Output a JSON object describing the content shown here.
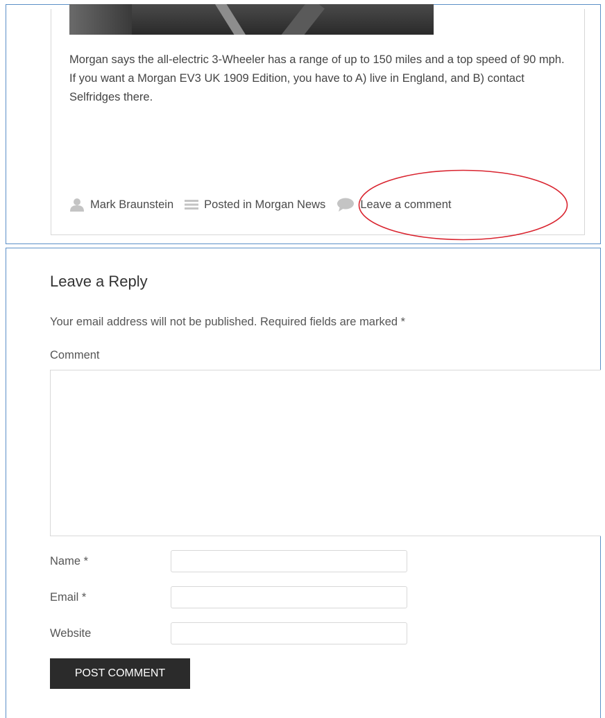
{
  "article": {
    "body_text": "Morgan says the all-electric 3-Wheeler has a range of up to 150 miles and a top speed of 90 mph. If you want a Morgan EV3 UK 1909 Edition, you have to A) live in England, and B) contact Selfridges there.",
    "meta": {
      "author": "Mark Braunstein",
      "category_text": "Posted in Morgan News",
      "comment_link": "Leave a comment"
    },
    "icons": {
      "author": "user-icon",
      "category": "list-icon",
      "comment": "speech-bubble-icon"
    },
    "highlight_color": "#d9232e"
  },
  "reply": {
    "title": "Leave a Reply",
    "notes": "Your email address will not be published. Required fields are marked *",
    "comment_label": "Comment",
    "comment_value": "",
    "fields": [
      {
        "label": "Name *",
        "value": ""
      },
      {
        "label": "Email *",
        "value": ""
      },
      {
        "label": "Website",
        "value": ""
      }
    ],
    "submit_label": "POST COMMENT"
  },
  "colors": {
    "frame_border": "#5b8fc7",
    "button_bg": "#2b2b2b",
    "meta_icon": "#c4c4c4"
  }
}
